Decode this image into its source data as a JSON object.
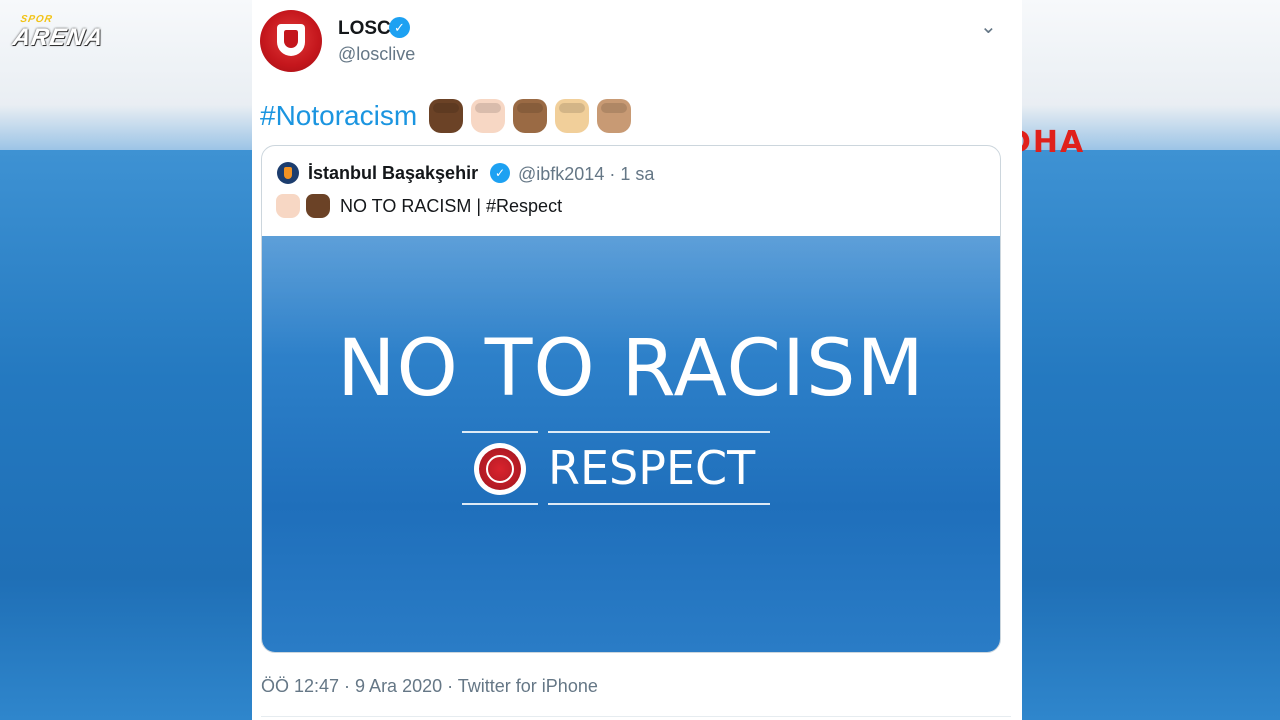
{
  "watermarks": {
    "spor_small": "SPOR",
    "spor_big": "ARENA",
    "dha": "DHA"
  },
  "tweet": {
    "author_name": "LOSC",
    "author_handle": "@losclive",
    "hashtag": "#Notoracism",
    "fist_emoji_colors": [
      "#6b4226",
      "#f7d7c4",
      "#9a6a44",
      "#f1cf9a",
      "#c89a74"
    ],
    "footer": "ÖÖ 12:47 · 9 Ara 2020 · Twitter for iPhone"
  },
  "quoted_tweet": {
    "author_name": "İstanbul Başakşehir",
    "author_handle_time": "@ibfk2014 · 1 sa",
    "fist_emoji_colors": [
      "#f7d7c4",
      "#6b4226"
    ],
    "text": "NO TO RACISM | #Respect",
    "media": {
      "headline": "NO TO RACISM",
      "subline": "RESPECT"
    }
  },
  "icons": {
    "verified": "verified-badge-icon",
    "chevron": "chevron-down-icon"
  },
  "colors": {
    "link": "#1b95e0",
    "verified": "#1da1f2",
    "dha_red": "#e0201b"
  }
}
